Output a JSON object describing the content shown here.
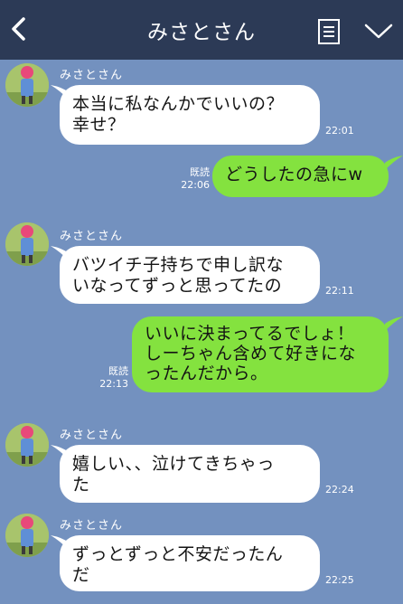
{
  "header": {
    "title": "みさとさん",
    "back_icon": "chevron-left-icon",
    "menu_icon": "notes-icon",
    "expand_icon": "chevron-down-icon",
    "background": "#2c3a56"
  },
  "colors": {
    "chat_background": "#7391bf",
    "incoming_bubble": "#ffffff",
    "outgoing_bubble": "#84e23f"
  },
  "messages": [
    {
      "direction": "incoming",
      "sender": "みさとさん",
      "lines": [
        "本当に私なんかでいいの？",
        "幸せ？"
      ],
      "time": "22:01"
    },
    {
      "direction": "outgoing",
      "lines": [
        "どうしたの急にw"
      ],
      "read": "既読",
      "time": "22:06"
    },
    {
      "direction": "incoming",
      "sender": "みさとさん",
      "lines": [
        "バツイチ子持ちで申し訳な",
        "いなってずっと思ってたの"
      ],
      "time": "22:11"
    },
    {
      "direction": "outgoing",
      "lines": [
        "いいに決まってるでしょ！",
        "しーちゃん含めて好きにな",
        "ったんだから。"
      ],
      "read": "既読",
      "time": "22:13"
    },
    {
      "direction": "incoming",
      "sender": "みさとさん",
      "lines": [
        "嬉しい、、泣けてきちゃっ",
        "た"
      ],
      "time": "22:24"
    },
    {
      "direction": "incoming",
      "sender": "みさとさん",
      "lines": [
        "ずっとずっと不安だったん",
        "だ"
      ],
      "time": "22:25"
    }
  ]
}
